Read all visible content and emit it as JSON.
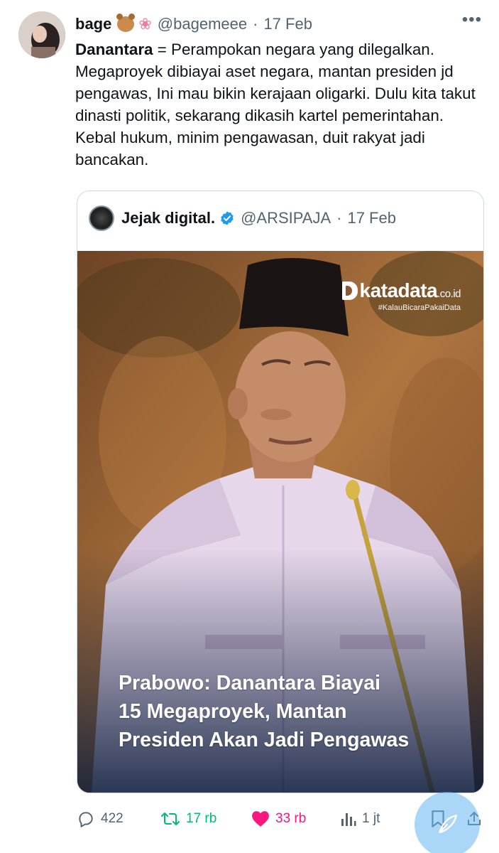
{
  "tweet": {
    "display_name": "bage",
    "handle": "@bagemeee",
    "dot": "·",
    "date": "17 Feb",
    "more_icon": "more-icon",
    "text_bold": "Danantara",
    "text_rest": " = Perampokan negara yang dilegalkan. Megaproyek dibiayai aset negara, mantan presiden jd pengawas, Ini mau bikin kerajaan oligarki. Dulu kita takut dinasti politik, sekarang dikasih kartel pemerintahan. Kebal hukum, minim pengawasan, duit rakyat jadi bancakan."
  },
  "quote": {
    "display_name": "Jejak digital.",
    "handle": "@ARSIPAJA",
    "dot": "·",
    "date": "17 Feb",
    "verified_color": "#1d9bf0",
    "media": {
      "brand": "katadata",
      "brand_suffix": ".co.id",
      "brand_tag": "#KalauBicaraPakaiData",
      "headline_line1": "Prabowo: Danantara Biayai",
      "headline_line2": "15 Megaproyek, Mantan",
      "headline_line3": "Presiden Akan Jadi Pengawas",
      "stripe_colors": [
        "#2d2f6e",
        "#2d2f6e",
        "#36a3d9",
        "#36a3d9",
        "#2d2f6e",
        "#e0458a"
      ]
    }
  },
  "actions": {
    "replies": "422",
    "reposts": "17 rb",
    "likes": "33 rb",
    "views": "1 jt",
    "repost_color": "#00ba7c",
    "like_color": "#f91880"
  }
}
